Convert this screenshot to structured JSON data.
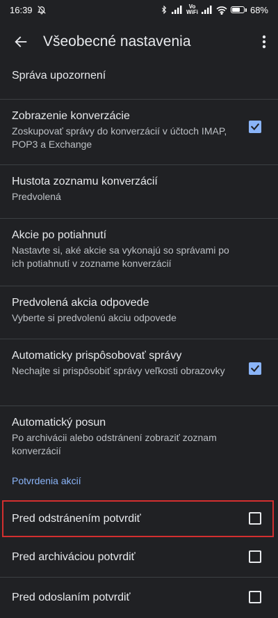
{
  "status_bar": {
    "time": "16:39",
    "volte_top": "Vo",
    "volte_bottom": "WiFi",
    "battery_percent": "68%",
    "battery_level": 0.68
  },
  "app_bar": {
    "title": "Všeobecné nastavenia",
    "back_icon": "arrow-back-icon",
    "more_icon": "more-vert-icon"
  },
  "settings": [
    {
      "title": "Správa upozornení",
      "subtitle": ""
    },
    {
      "title": "Zobrazenie konverzácie",
      "subtitle": "Zoskupovať správy do konverzácií v účtoch IMAP, POP3 a Exchange",
      "checked": true
    },
    {
      "title": "Hustota zoznamu konverzácií",
      "subtitle": "Predvolená"
    },
    {
      "title": "Akcie po potiahnutí",
      "subtitle": "Nastavte si, aké akcie sa vykonajú so správami po ich potiahnutí v zozname konverzácií"
    },
    {
      "title": "Predvolená akcia odpovede",
      "subtitle": "Vyberte si predvolenú akciu odpovede"
    },
    {
      "title": "Automaticky prispôsobovať správy",
      "subtitle": "Nechajte si prispôsobiť správy veľkosti obrazovky",
      "checked": true
    },
    {
      "title": "Automatický posun",
      "subtitle": "Po archivácii alebo odstránení zobraziť zoznam konverzácií"
    }
  ],
  "section_header": "Potvrdenia akcií",
  "confirm_settings": [
    {
      "title": "Pred odstránením potvrdiť",
      "checked": false,
      "highlighted": true
    },
    {
      "title": "Pred archiváciou potvrdiť",
      "checked": false
    },
    {
      "title": "Pred odoslaním potvrdiť",
      "checked": false
    }
  ],
  "colors": {
    "background": "#202124",
    "accent": "#8ab4f8",
    "highlight_border": "#d32f2f"
  }
}
